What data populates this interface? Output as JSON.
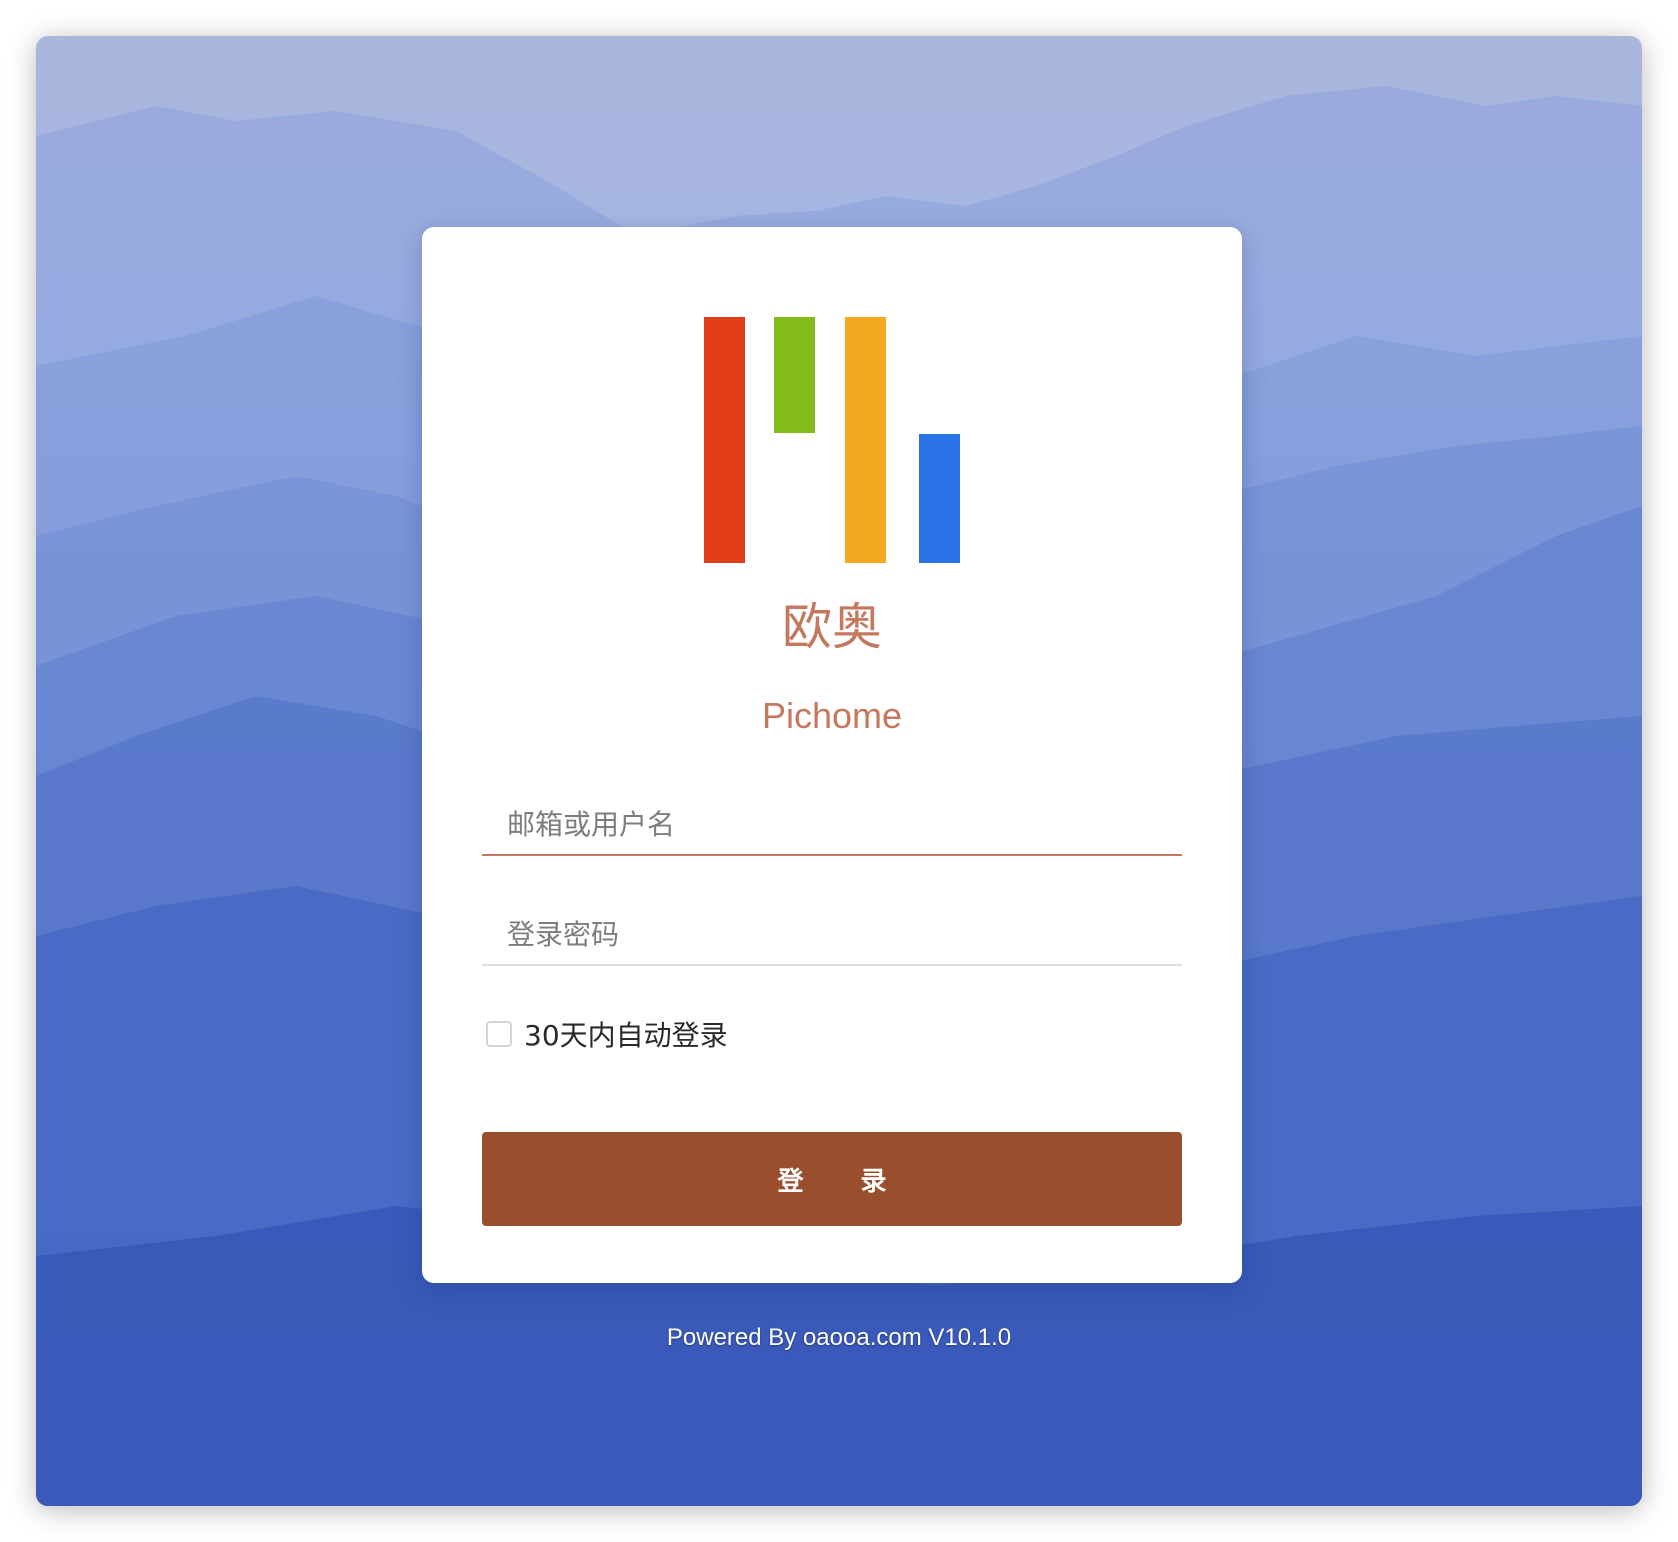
{
  "colors": {
    "logo_red": "#e03c15",
    "logo_green": "#82bb1a",
    "logo_orange": "#f3a822",
    "logo_blue": "#2a72e8",
    "brand_text": "#c4785e",
    "login_button": "#994e2d",
    "input_active_underline": "#c47a5f"
  },
  "brand": {
    "name_cn": "欧奥",
    "name_en": "Pichome"
  },
  "form": {
    "username_placeholder": "邮箱或用户名",
    "username_value": "",
    "password_placeholder": "登录密码",
    "password_value": "",
    "remember_label": "30天内自动登录",
    "remember_checked": false,
    "login_label": "登 录"
  },
  "footer": {
    "text": "Powered By oaooa.com V10.1.0"
  }
}
